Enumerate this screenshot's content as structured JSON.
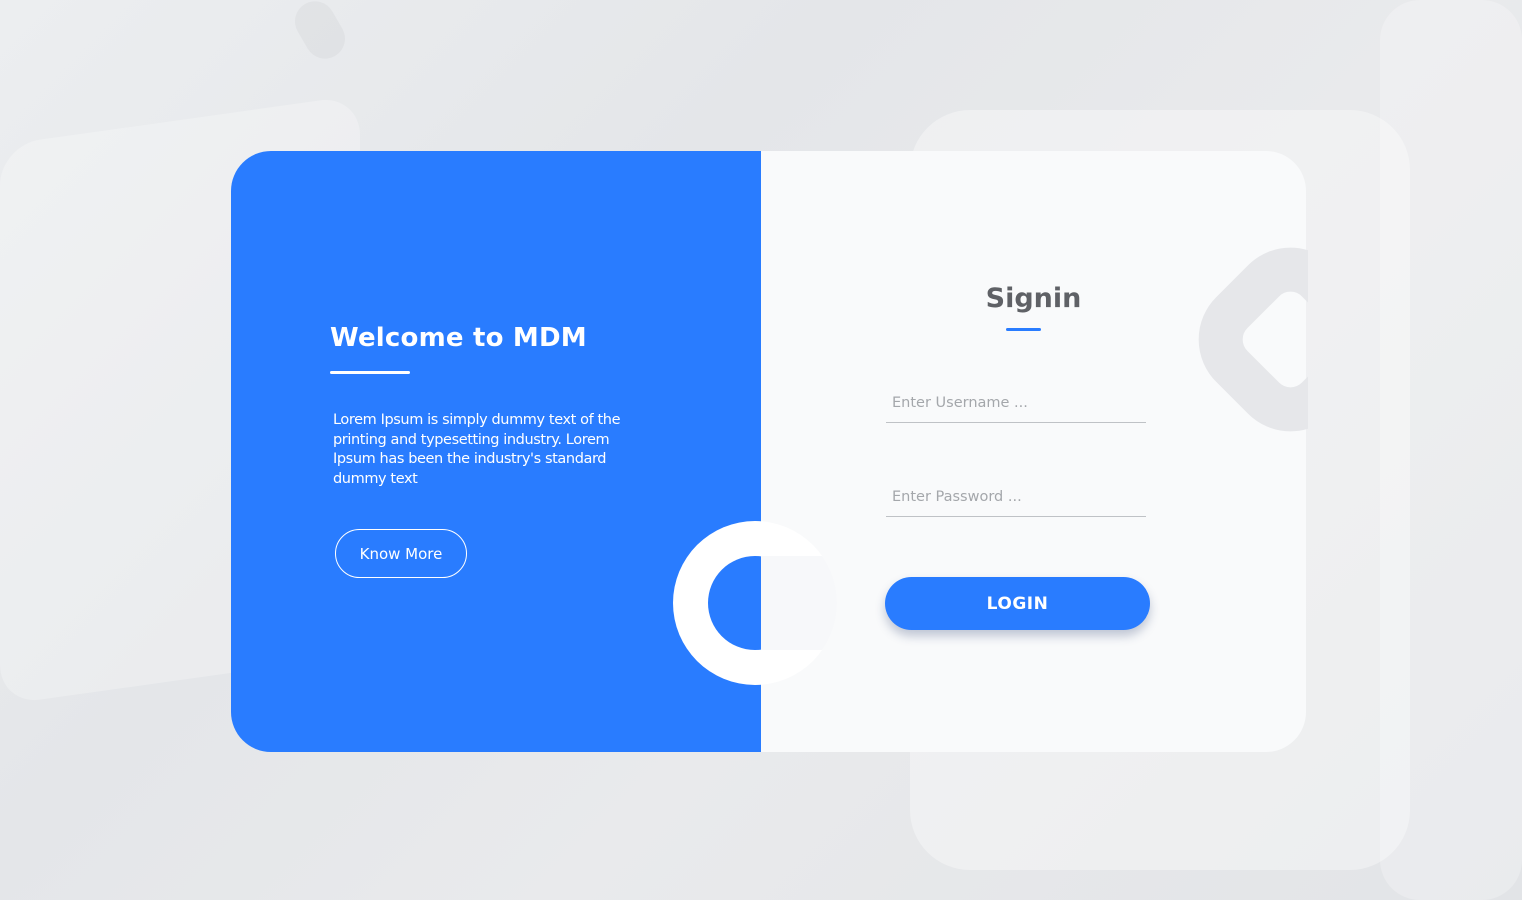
{
  "welcome": {
    "title": "Welcome to MDM",
    "description": "Lorem Ipsum is simply dummy text of the printing and typesetting industry. Lorem Ipsum has been the industry's standard dummy text",
    "know_more_label": "Know More"
  },
  "signin": {
    "title": "Signin",
    "username_placeholder": "Enter Username ...",
    "password_placeholder": "Enter Password ...",
    "login_label": "LOGIN"
  },
  "colors": {
    "accent": "#297cff",
    "panel_light": "#f9fafb",
    "text_dark": "#5f6166"
  }
}
